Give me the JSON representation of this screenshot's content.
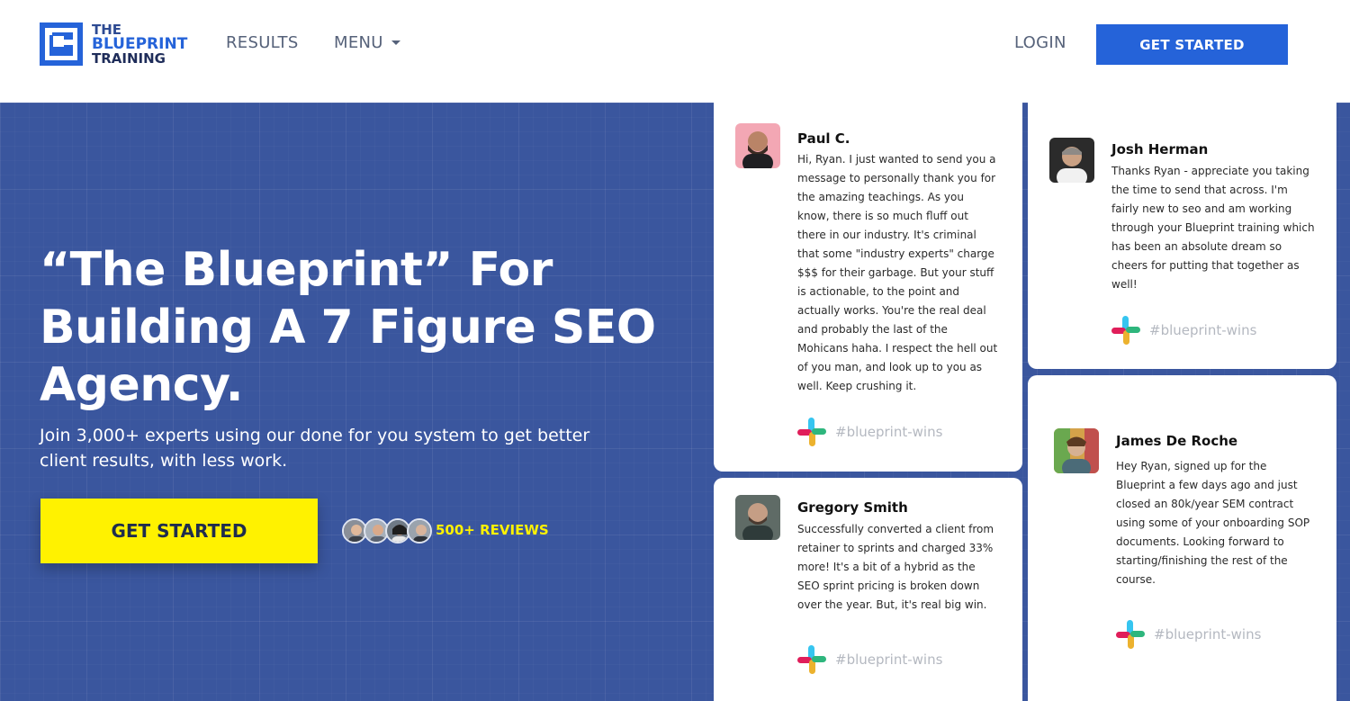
{
  "header": {
    "logo": {
      "line1": "THE",
      "line2": "BLUEPRINT",
      "line3": "TRAINING"
    },
    "nav": {
      "results": "RESULTS",
      "menu": "MENU",
      "login": "LOGIN"
    },
    "cta": "GET STARTED"
  },
  "hero": {
    "headline_1": "“The Blueprint” For",
    "headline_2": "Building A 7 Figure SEO",
    "headline_3": "Agency.",
    "subhead": "Join 3,000+ experts using our done for you system to get better client results, with less work.",
    "cta": "GET STARTED",
    "reviews": "500+ REVIEWS"
  },
  "testimonials": [
    {
      "name": "Paul C.",
      "text": "Hi, Ryan. I just wanted to send you a message to personally thank you for the amazing teachings. As you know, there is so much fluff out there in our industry. It's criminal that some \"industry experts\" charge $$$ for their garbage. But your stuff is actionable, to the point and actually works. You're the real deal and probably the last of the Mohicans haha. I respect the hell out of you man, and look up to you as well. Keep crushing it.",
      "tag": "#blueprint-wins"
    },
    {
      "name": "Josh Herman",
      "text": "Thanks Ryan - appreciate you taking the time to send that across. I'm fairly new to seo and am working through your Blueprint training which has been an absolute dream so cheers for putting that together as well!",
      "tag": "#blueprint-wins"
    },
    {
      "name": "Gregory Smith",
      "text": "Successfully converted a client from retainer to sprints and charged 33% more! It's a bit of a hybrid as the SEO sprint pricing is broken down over the year. But, it's real big win.",
      "tag": "#blueprint-wins"
    },
    {
      "name": "James De Roche",
      "text": "Hey Ryan, signed up for the Blueprint a few days ago and just closed an 80k/year SEM contract using some of your onboarding SOP documents. Looking forward to starting/finishing the rest of the course.",
      "tag": "#blueprint-wins"
    }
  ],
  "colors": {
    "brand_blue": "#2563d9",
    "hero_bg": "#3a569e",
    "cta_yellow": "#fff200"
  }
}
